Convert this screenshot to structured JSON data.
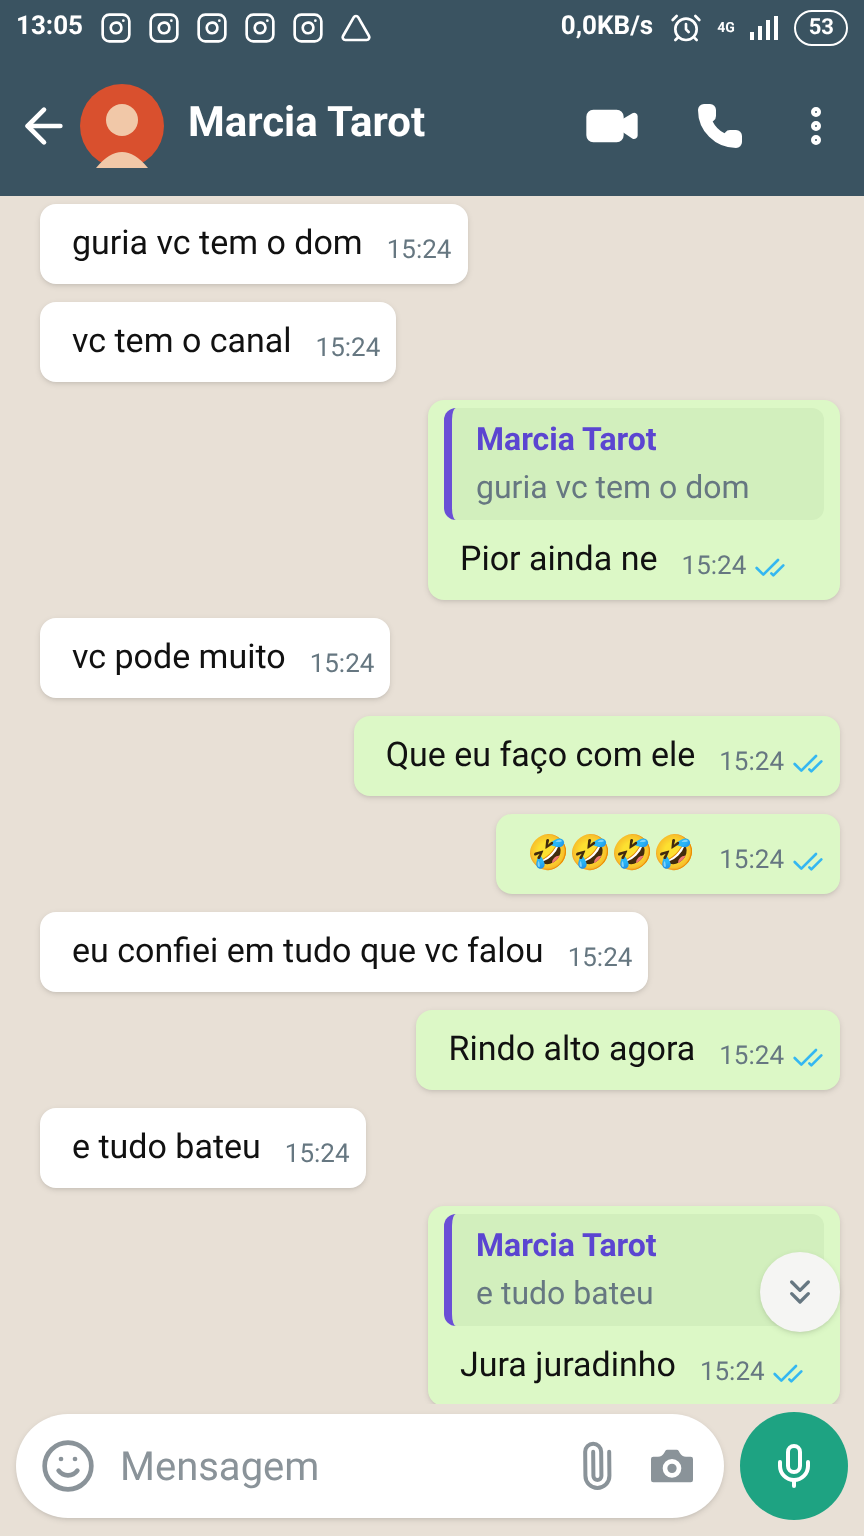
{
  "status_bar": {
    "time": "13:05",
    "speed": "0,0KB/s",
    "network": "4G",
    "battery": "53"
  },
  "header": {
    "title": "Marcia Tarot"
  },
  "messages": [
    {
      "kind": "in",
      "text": "guria vc tem o dom",
      "time": "15:24"
    },
    {
      "kind": "in",
      "text": "vc tem o canal",
      "time": "15:24"
    },
    {
      "kind": "out",
      "quote": {
        "author": "Marcia Tarot",
        "text": "guria vc tem o dom"
      },
      "text": "Pior ainda ne",
      "time": "15:24",
      "read": true
    },
    {
      "kind": "in",
      "text": "vc pode muito",
      "time": "15:24"
    },
    {
      "kind": "out",
      "text": "Que eu faço com ele",
      "time": "15:24",
      "read": true
    },
    {
      "kind": "out",
      "text": "🤣🤣🤣🤣",
      "time": "15:24",
      "read": true
    },
    {
      "kind": "in",
      "text": "eu confiei em tudo que vc falou",
      "time": "15:24"
    },
    {
      "kind": "out",
      "text": "Rindo alto agora",
      "time": "15:24",
      "read": true
    },
    {
      "kind": "in",
      "text": "e tudo bateu",
      "time": "15:24"
    },
    {
      "kind": "out",
      "quote": {
        "author": "Marcia Tarot",
        "text": "e tudo bateu"
      },
      "text": "Jura juradinho",
      "time": "15:24",
      "read": true
    }
  ],
  "composer": {
    "placeholder": "Mensagem"
  }
}
